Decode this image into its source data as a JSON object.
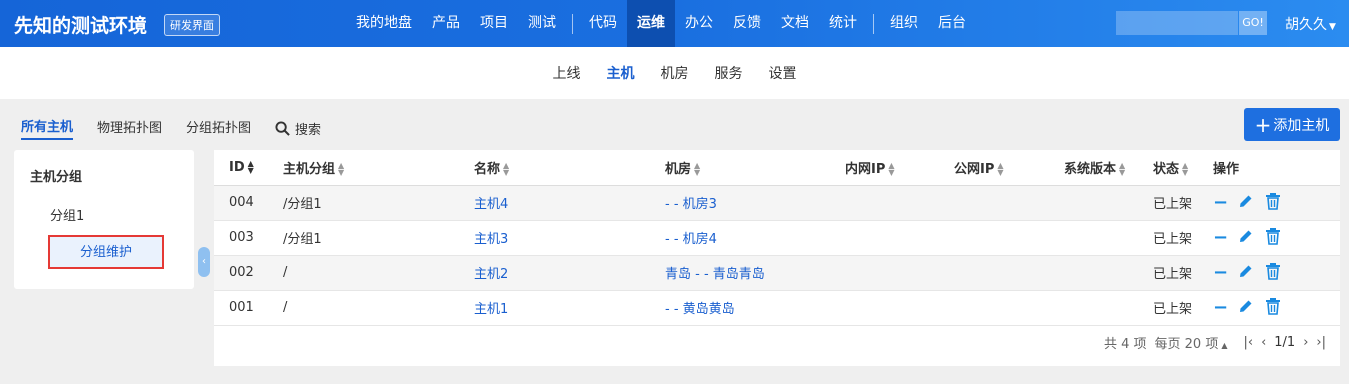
{
  "header": {
    "brand": "先知的测试环境",
    "badge": "研发界面",
    "nav": [
      "我的地盘",
      "产品",
      "项目",
      "测试",
      "代码",
      "运维",
      "办公",
      "反馈",
      "文档",
      "统计",
      "组织",
      "后台"
    ],
    "active_nav": "运维",
    "go_label": "GO!",
    "user": "胡久久"
  },
  "subnav": {
    "items": [
      "上线",
      "主机",
      "机房",
      "服务",
      "设置"
    ],
    "active": "主机"
  },
  "tabs": {
    "items": [
      "所有主机",
      "物理拓扑图",
      "分组拓扑图"
    ],
    "search": "搜索"
  },
  "add_button": "添加主机",
  "sidebar": {
    "title": "主机分组",
    "items": [
      "分组1"
    ],
    "maintain": "分组维护"
  },
  "table": {
    "columns": [
      "ID",
      "主机分组",
      "名称",
      "机房",
      "内网IP",
      "公网IP",
      "系统版本",
      "状态",
      "操作"
    ],
    "rows": [
      {
        "id": "004",
        "group": "/分组1",
        "name": "主机4",
        "room": "- - 机房3",
        "status": "已上架"
      },
      {
        "id": "003",
        "group": "/分组1",
        "name": "主机3",
        "room": "- - 机房4",
        "status": "已上架"
      },
      {
        "id": "002",
        "group": "/",
        "name": "主机2",
        "room": "青岛 - - 青岛青岛",
        "status": "已上架"
      },
      {
        "id": "001",
        "group": "/",
        "name": "主机1",
        "room": "- - 黄岛黄岛",
        "status": "已上架"
      }
    ]
  },
  "pager": {
    "total": "共 4 项",
    "per_page": "每页 20 项",
    "page": "1/1"
  }
}
